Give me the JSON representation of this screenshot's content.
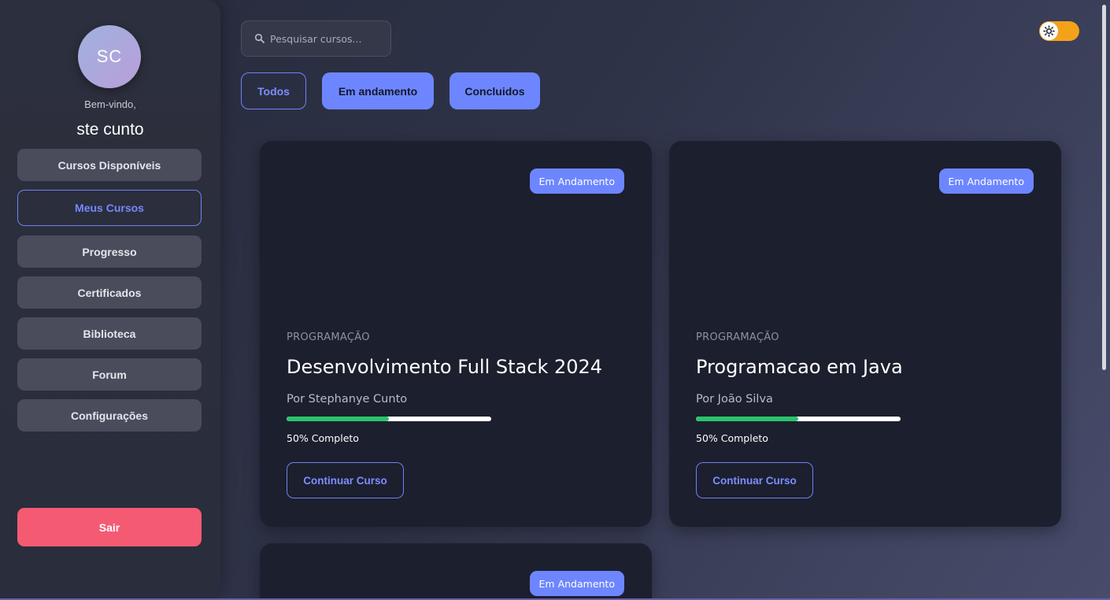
{
  "sidebar": {
    "avatar_initials": "SC",
    "welcome": "Bem-vindo,",
    "username": "ste cunto",
    "nav_items": [
      {
        "label": "Cursos Disponíveis",
        "active": false
      },
      {
        "label": "Meus Cursos",
        "active": true
      },
      {
        "label": "Progresso",
        "active": false
      },
      {
        "label": "Certificados",
        "active": false
      },
      {
        "label": "Biblioteca",
        "active": false
      },
      {
        "label": "Forum",
        "active": false
      },
      {
        "label": "Configurações",
        "active": false
      }
    ],
    "logout_label": "Sair"
  },
  "search": {
    "placeholder": "Pesquisar cursos...",
    "icon": "search-icon"
  },
  "theme_toggle": {
    "icon": "sun-icon",
    "state": "light-off"
  },
  "filters": [
    {
      "label": "Todos",
      "style": "outline"
    },
    {
      "label": "Em andamento",
      "style": "solid"
    },
    {
      "label": "Concluidos",
      "style": "solid"
    }
  ],
  "courses": [
    {
      "status": "Em Andamento",
      "category": "PROGRAMAÇÃO",
      "title": "Desenvolvimento Full Stack 2024",
      "author": "Por Stephanye Cunto",
      "progress": 0.5,
      "progress_text": "50% Completo",
      "action": "Continuar Curso"
    },
    {
      "status": "Em Andamento",
      "category": "PROGRAMAÇÃO",
      "title": "Programacao em Java",
      "author": "Por João Silva",
      "progress": 0.5,
      "progress_text": "50% Completo",
      "action": "Continuar Curso"
    },
    {
      "status": "Em Andamento"
    }
  ],
  "colors": {
    "accent": "#6d86ff",
    "progress": "#2ac36c",
    "logout": "#f45b73",
    "toggle": "#f5a21b"
  }
}
